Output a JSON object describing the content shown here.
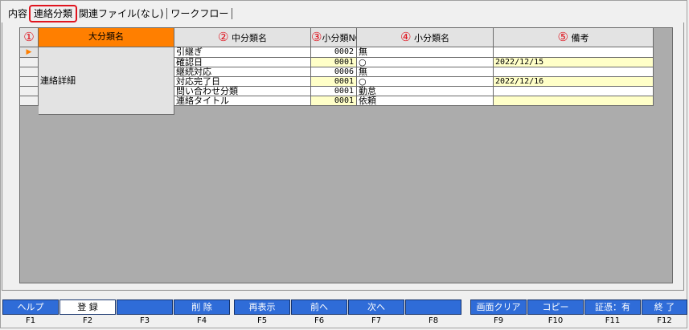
{
  "tabs": [
    {
      "label": "内容"
    },
    {
      "label": "連絡分類"
    },
    {
      "label": "関連ファイル(なし)"
    },
    {
      "label": "ワークフロー"
    }
  ],
  "annotations": [
    "①",
    "②",
    "③",
    "④",
    "⑤"
  ],
  "columns": {
    "major": "大分類名",
    "middle": "中分類名",
    "minor_no": "小分類NO",
    "minor_name": "小分類名",
    "note": "備考"
  },
  "major_value": "連絡詳細",
  "rows": [
    {
      "middle": "引継ぎ",
      "no": "0002",
      "name": "無",
      "note": ""
    },
    {
      "middle": "確認日",
      "no": "0001",
      "name": "○",
      "note": "2022/12/15"
    },
    {
      "middle": "継続対応",
      "no": "0006",
      "name": "無",
      "note": ""
    },
    {
      "middle": "対応完了日",
      "no": "0001",
      "name": "○",
      "note": "2022/12/16"
    },
    {
      "middle": "問い合わせ分類",
      "no": "0001",
      "name": "勤怠",
      "note": ""
    },
    {
      "middle": "連絡タイトル",
      "no": "0001",
      "name": "依頼",
      "note": ""
    }
  ],
  "row_pointer": "▶",
  "fkeys": [
    {
      "label": "ヘルプ",
      "key": "F1"
    },
    {
      "label": "登 録",
      "key": "F2"
    },
    {
      "label": "",
      "key": "F3"
    },
    {
      "label": "削 除",
      "key": "F4"
    },
    {
      "label": "再表示",
      "key": "F5"
    },
    {
      "label": "前へ",
      "key": "F6"
    },
    {
      "label": "次へ",
      "key": "F7"
    },
    {
      "label": "",
      "key": "F8"
    },
    {
      "label": "画面クリア",
      "key": "F9"
    },
    {
      "label": "コピー",
      "key": "F10"
    },
    {
      "label": "証憑：有",
      "key": "F11"
    },
    {
      "label": "終 了",
      "key": "F12"
    }
  ],
  "colors": {
    "header_orange": "#ff7f00",
    "yellow_row": "#ffffc8",
    "fkey_blue": "#2f6cd8",
    "annotation_red": "#e0141e"
  }
}
